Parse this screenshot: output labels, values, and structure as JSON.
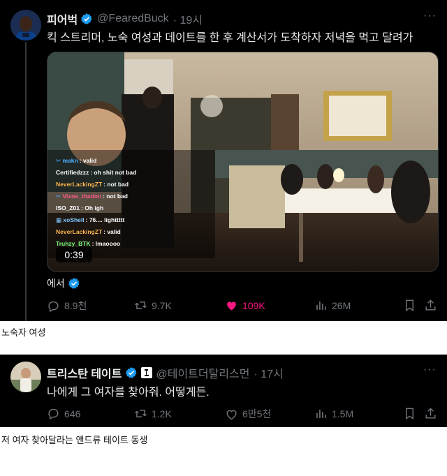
{
  "tweet1": {
    "display_name": "피어벅",
    "handle": "@FearedBuck",
    "time": "· 19시",
    "more": "···",
    "text": "킥 스트리머, 노숙 여성과 데이트를 한 후 계산서가 도착하자 저녁을 먹고 달려가",
    "from_label": "에서",
    "stats": {
      "replies": "8.9천",
      "retweets": "9.7K",
      "likes": "109K",
      "views": "26M"
    },
    "video": {
      "timer": "0:39",
      "chat": [
        {
          "user": "makn",
          "msg": ": valid",
          "color": "#4fb0ff",
          "prefix": "✂"
        },
        {
          "user": "Certifiedzzz",
          "msg": ": oh shit not bad",
          "color": "#ffffff",
          "prefix": ""
        },
        {
          "user": "NeverLackingZT",
          "msg": ": not bad",
          "color": "#ffb54f",
          "prefix": ""
        },
        {
          "user": "Vixne_thadon",
          "msg": ": not bad",
          "color": "#ff5a8a",
          "prefix": "✂"
        },
        {
          "user": "ISO_Z01",
          "msg": ": Oh igh",
          "color": "#ffffff",
          "prefix": ""
        },
        {
          "user": "xoShell",
          "msg": ": 76.... lighttttt",
          "color": "#7ec8ff",
          "prefix": "▦"
        },
        {
          "user": "NeverLackingZT",
          "msg": ": valid",
          "color": "#ffb54f",
          "prefix": ""
        },
        {
          "user": "Truhzy_BTK",
          "msg": ": lmaoooo",
          "color": "#7dff7d",
          "prefix": ""
        }
      ]
    }
  },
  "caption1": "노숙자 여성",
  "tweet2": {
    "display_name": "트리스탄 테이트",
    "handle": "@테이트더탈리스먼",
    "time": "· 17시",
    "more": "···",
    "text": "나에게 그 여자를 찾아줘. 어떻게든.",
    "stats": {
      "replies": "646",
      "retweets": "1.2K",
      "likes": "6만5천",
      "views": "1.5M"
    }
  },
  "caption2": "저 여자 찾아달라는 앤드류 테이트 동생",
  "colors": {
    "like_active": "#f91880",
    "verified": "#1d9bf0",
    "muted": "#71767b"
  }
}
